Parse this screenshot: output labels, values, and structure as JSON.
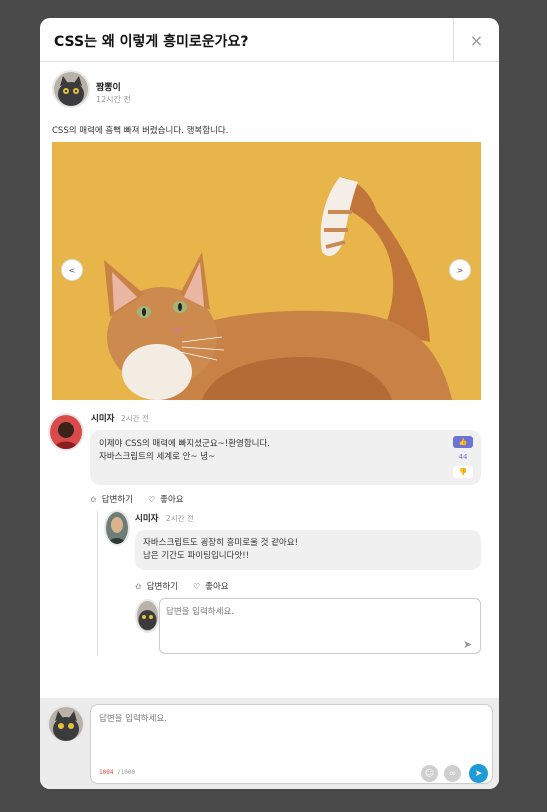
{
  "modal": {
    "title": "CSS는 왜 이렇게 흥미로운가요?",
    "close_icon": "×"
  },
  "post": {
    "author": "짬뽕이",
    "time": "12시간 전",
    "text": "CSS의 매력에 흠뻑 빠져 버렸습니다. 행복합니다.",
    "prev_label": "<",
    "next_label": ">"
  },
  "comment": {
    "author": "시미자",
    "time": "2시간 전",
    "line1": "이제야 CSS의 매력에 빠지셨군요~!환영합니다.",
    "line2": "자바스크립트의 세계로 안~ 녕~",
    "like_count": "44",
    "reply_label": "답변하기",
    "love_label": "좋아요"
  },
  "reply": {
    "author": "시미자",
    "time": "2시간 전",
    "line1": "자바스크립트도 굉장히 흥미로울 것 같아요!",
    "line2": "남은 기간도 파이팅입니다앗!!",
    "reply_label": "답변하기",
    "love_label": "좋아요",
    "input_placeholder": "답변을 입력하세요."
  },
  "footer": {
    "input_placeholder": "답변을 입력하세요.",
    "count_current": "1004",
    "count_max": "/1000"
  },
  "colors": {
    "accent": "#6b74d6",
    "send": "#1e9bd7",
    "photo_bg": "#e8b54a"
  }
}
